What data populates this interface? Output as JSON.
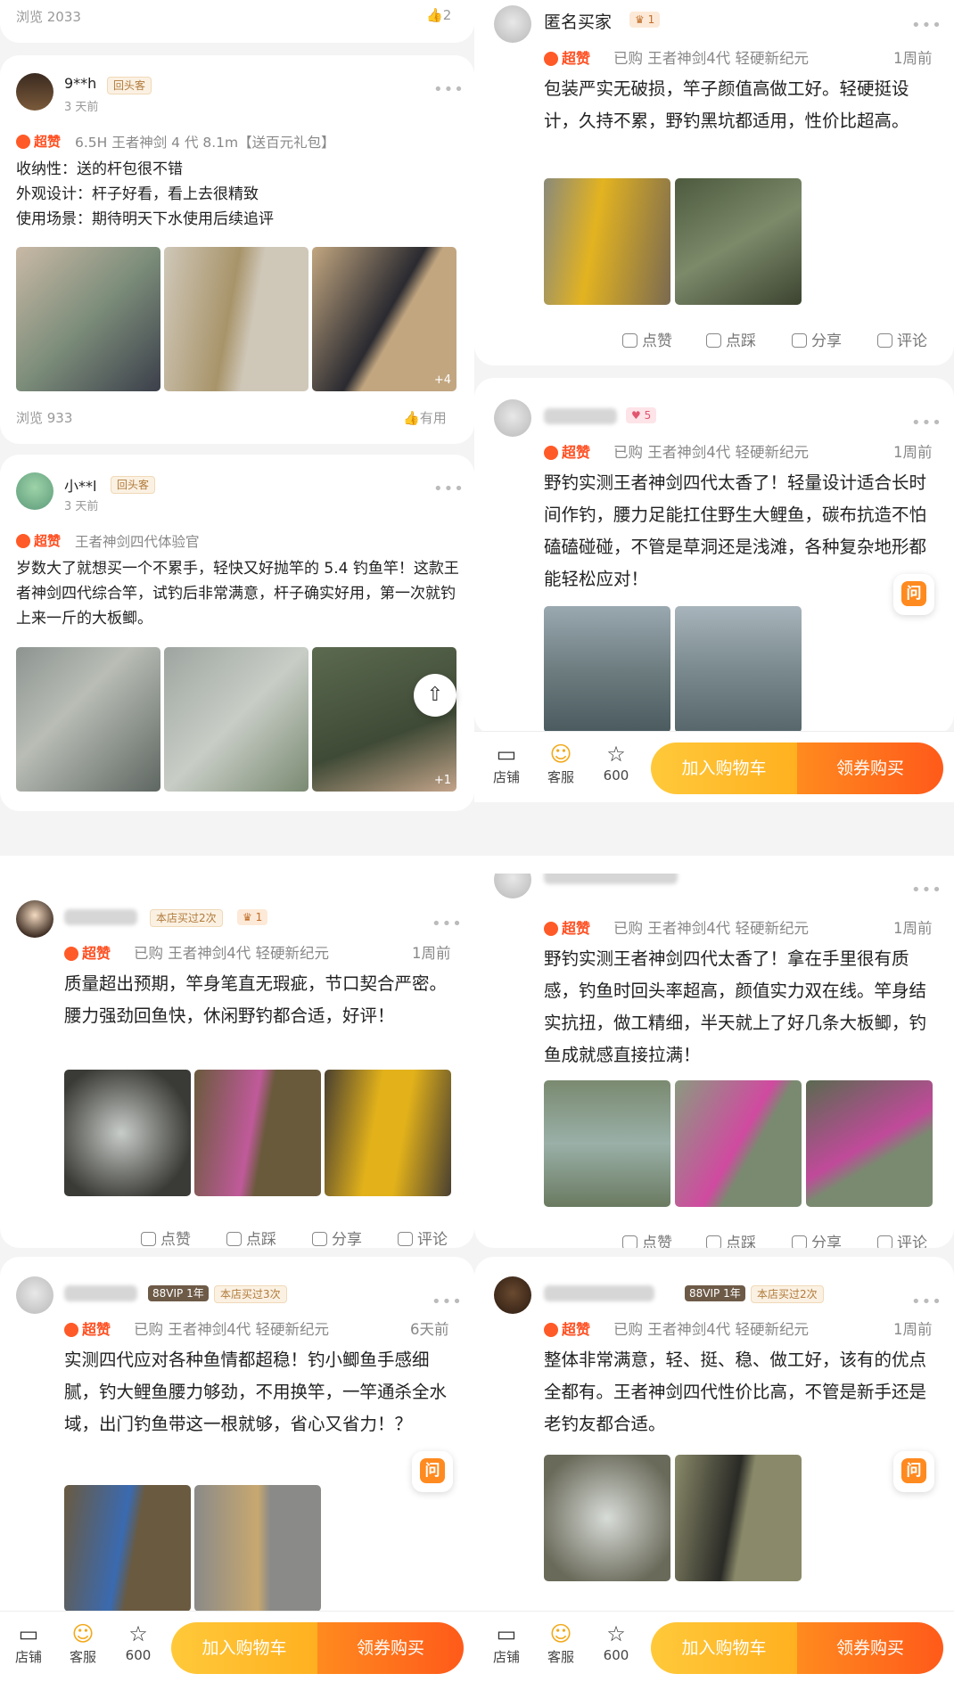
{
  "panel_a": {
    "top_stub": {
      "views": "浏览 2033",
      "likes": "2"
    },
    "review1": {
      "user": "9**h",
      "tag": "回头客",
      "time": "3 天前",
      "badge": "超赞",
      "spec": "6.5H 王者神剑 4 代 8.1m【送百元礼包】",
      "lines": [
        "收纳性：送的杆包很不错",
        "外观设计：杆子好看，看上去很精致",
        "使用场景：期待明天下水使用后续追评"
      ],
      "more_count": "+4",
      "views": "浏览 933",
      "helpful": "有用"
    },
    "review2": {
      "user": "小**l",
      "tag": "回头客",
      "time": "3 天前",
      "badge": "超赞",
      "spec": "王者神剑四代体验官",
      "text": "岁数大了就想买一个不累手，轻快又好抛竿的 5.4 钓鱼竿！这款王者神剑四代综合竿，试钓后非常满意，杆子确实好用，第一次就钓上来一斤的大板鲫。",
      "more_count": "+1"
    }
  },
  "panel_b": {
    "review1": {
      "user": "匿名买家",
      "crown": "1",
      "badge": "超赞",
      "spec": "已购 王者神剑4代 轻硬新纪元",
      "ago": "1周前",
      "text": "包装严实无破损，竿子颜值高做工好。轻硬挺设计，久持不累，野钓黑坑都适用，性价比超高。"
    },
    "review2": {
      "heart": "5",
      "badge": "超赞",
      "spec": "已购 王者神剑4代 轻硬新纪元",
      "ago": "1周前",
      "text": "野钓实测王者神剑四代太香了！轻量设计适合长时间作钓，腰力足能扛住野生大鲤鱼，碳布抗造不怕磕磕碰碰，不管是草洞还是浅滩，各种复杂地形都能轻松应对！"
    }
  },
  "panel_c": {
    "review1": {
      "tag": "本店买过2次",
      "crown": "1",
      "badge": "超赞",
      "spec": "已购 王者神剑4代 轻硬新纪元",
      "ago": "1周前",
      "text": "质量超出预期，竿身笔直无瑕疵，节口契合严密。腰力强劲回鱼快，休闲野钓都合适，好评！"
    },
    "review2": {
      "vip": "88VIP",
      "vip_year": "1年",
      "tag": "本店买过3次",
      "badge": "超赞",
      "spec": "已购 王者神剑4代 轻硬新纪元",
      "ago": "6天前",
      "text": "实测四代应对各种鱼情都超稳！钓小鲫鱼手感细腻，钓大鲤鱼腰力够劲，不用换竿，一竿通杀全水域，出门钓鱼带这一根就够，省心又省力！？"
    }
  },
  "panel_d": {
    "review1": {
      "badge": "超赞",
      "spec": "已购 王者神剑4代 轻硬新纪元",
      "ago": "1周前",
      "text": "野钓实测王者神剑四代太香了！拿在手里很有质感，钓鱼时回头率超高，颜值实力双在线。竿身结实抗扭，做工精细，半天就上了好几条大板鲫，钓鱼成就感直接拉满！"
    },
    "review2": {
      "vip": "88VIP",
      "vip_year": "1年",
      "tag": "本店买过2次",
      "badge": "超赞",
      "spec": "已购 王者神剑4代 轻硬新纪元",
      "ago": "1周前",
      "text": "整体非常满意，轻、挺、稳、做工好，该有的优点全都有。王者神剑四代性价比高，不管是新手还是老钓友都合适。"
    }
  },
  "actions": {
    "like": "点赞",
    "dislike": "点踩",
    "share": "分享",
    "comment": "评论"
  },
  "bottom_bar": {
    "shop": "店铺",
    "service": "客服",
    "fav_count": "600",
    "cart": "加入购物车",
    "buy": "领券购买"
  },
  "ask_label": "问"
}
